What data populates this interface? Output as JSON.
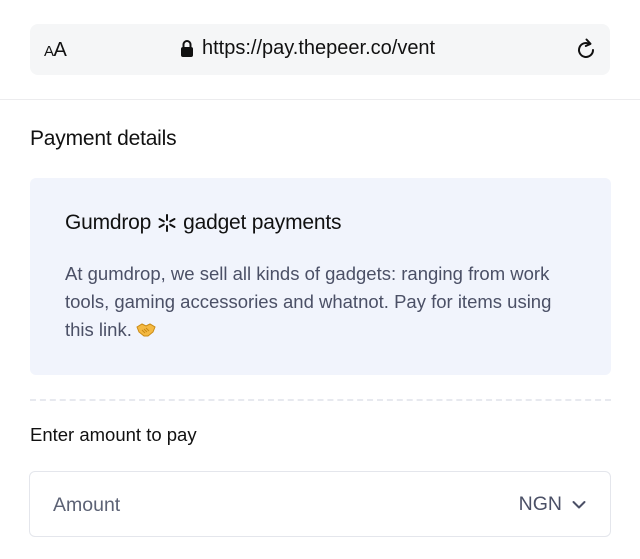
{
  "browser": {
    "text_size_label_small": "A",
    "text_size_label_large": "A",
    "url": "https://pay.thepeer.co/vent",
    "icons": {
      "lock": "lock-icon",
      "reload": "reload-icon"
    }
  },
  "page": {
    "section_title": "Payment details"
  },
  "card": {
    "merchant": "Gumdrop",
    "separator_icon": "asterisk-icon",
    "title_suffix": "gadget payments",
    "description": "At gumdrop, we sell all kinds of gadgets: ranging from work tools, gaming accessories and whatnot. Pay for items using this link.",
    "emoji_icon": "handshake-icon"
  },
  "amount": {
    "label": "Enter amount to pay",
    "placeholder": "Amount",
    "currency": "NGN",
    "dropdown_icon": "chevron-down-icon"
  },
  "colors": {
    "card_bg": "#f1f4fc",
    "muted_text": "#4b5066",
    "urlbar_bg": "#f5f6f7"
  }
}
